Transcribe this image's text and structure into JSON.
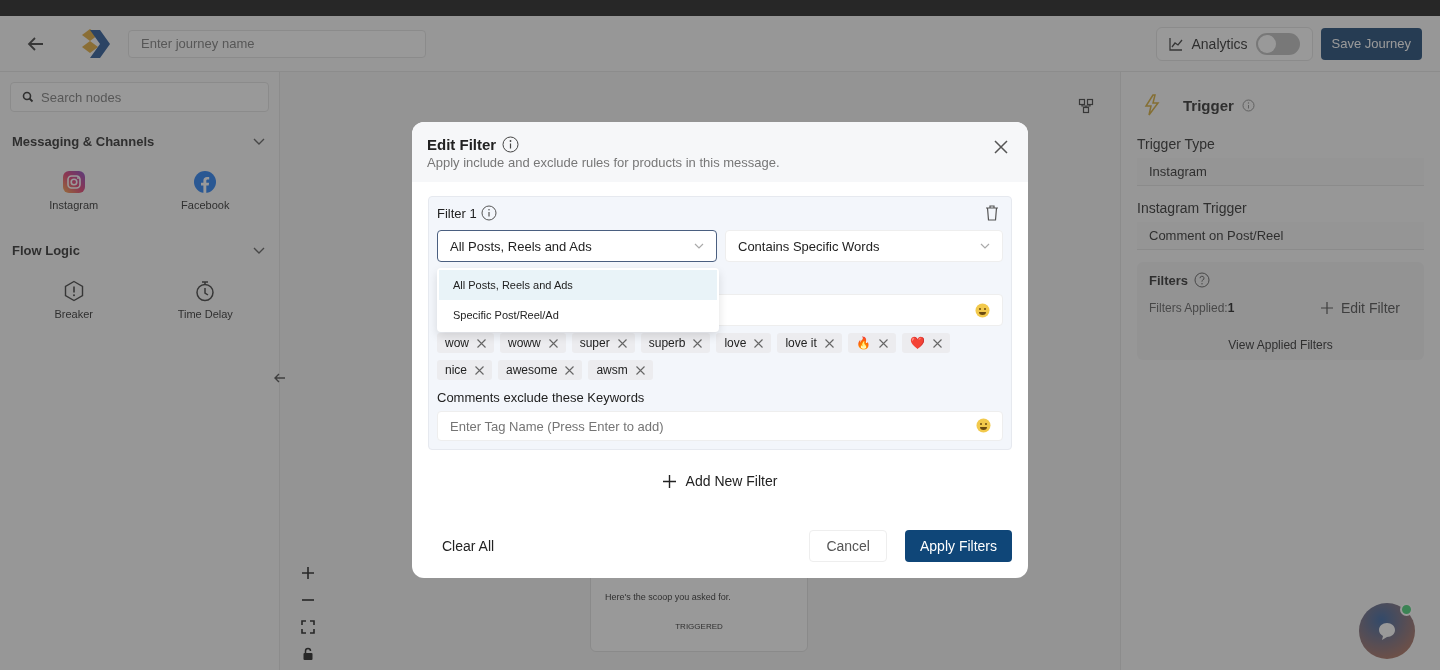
{
  "header": {
    "journey_name_placeholder": "Enter journey name",
    "analytics": {
      "label": "Analytics",
      "on": false
    },
    "save_button": "Save Journey"
  },
  "sidebar": {
    "search_placeholder": "Search nodes",
    "sections": [
      {
        "title": "Messaging & Channels",
        "expanded": true,
        "items": [
          {
            "label": "Instagram",
            "kind": "instagram"
          },
          {
            "label": "Facebook",
            "kind": "facebook"
          }
        ]
      },
      {
        "title": "Flow Logic",
        "expanded": true,
        "items": [
          {
            "label": "Breaker",
            "kind": "breaker"
          },
          {
            "label": "Time Delay",
            "kind": "timer"
          }
        ]
      }
    ]
  },
  "canvas": {
    "node_text": "Here's the scoop you asked for.",
    "node_status": "TRIGGERED"
  },
  "right_panel": {
    "title": "Trigger",
    "fields": [
      {
        "label": "Trigger Type",
        "value": "Instagram"
      },
      {
        "label": "Instagram Trigger",
        "value": "Comment on Post/Reel"
      }
    ],
    "filters": {
      "title": "Filters",
      "applied_label": "Filters Applied:",
      "applied_count": "1",
      "edit_button": "Edit Filter",
      "view_link": "View Applied Filters"
    }
  },
  "modal": {
    "title": "Edit Filter",
    "subtitle": "Apply include and exclude rules for products in this message.",
    "filters": [
      {
        "title": "Filter 1",
        "source": {
          "value": "All Posts, Reels and Ads",
          "expanded": true,
          "options": [
            {
              "label": "All Posts, Reels and Ads",
              "selected": true
            },
            {
              "label": "Specific Post/Reel/Ad",
              "selected": false
            }
          ]
        },
        "condition": "Contains Specific Words",
        "include_tags": [
          "wow",
          "woww",
          "super",
          "superb",
          "love",
          "love it",
          "🔥",
          "❤️",
          "nice",
          "awesome",
          "awsm"
        ],
        "exclude_label": "Comments exclude these Keywords",
        "exclude_placeholder": "Enter Tag Name (Press Enter to add)"
      }
    ],
    "add_button": "Add New Filter",
    "clear_button": "Clear All",
    "cancel_button": "Cancel",
    "apply_button": "Apply Filters"
  }
}
